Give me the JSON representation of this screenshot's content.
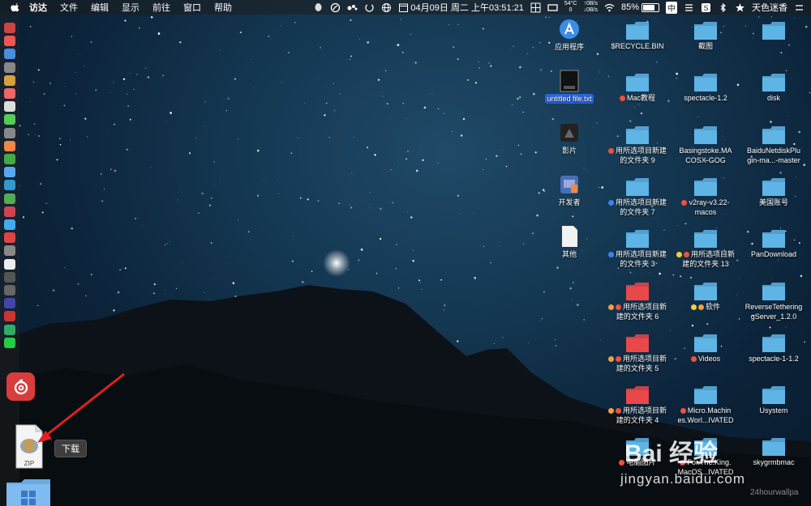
{
  "menubar": {
    "app_name": "访达",
    "menus": [
      "文件",
      "编辑",
      "显示",
      "前往",
      "窗口",
      "帮助"
    ],
    "datetime": "04月09日 周二 上午03:51:21",
    "cpu": {
      "temp": "54°C",
      "value": "0"
    },
    "net": {
      "up": "0B/s",
      "down": "0B/s"
    },
    "battery": "85%",
    "input_method": "中",
    "user": "天色迷香"
  },
  "dock": {
    "tooltip": "下载",
    "zip_label": "ZIP"
  },
  "desktop": {
    "left_column": [
      {
        "label": "应用程序",
        "icon": "app-store-icon"
      },
      {
        "label": "untitled file.txt",
        "icon": "txt-file-icon",
        "selected": true
      },
      {
        "label": "影片",
        "icon": "movies-icon"
      },
      {
        "label": "开发者",
        "icon": "developer-icon"
      },
      {
        "label": "其他",
        "icon": "document-icon"
      }
    ],
    "col2": [
      {
        "line1": "$RECYCLE.BIN",
        "line2": "",
        "color": "#5fb4e6",
        "tags": []
      },
      {
        "line1": "Mac教程",
        "line2": "",
        "color": "#5fb4e6",
        "tags": [
          "#f0503c"
        ]
      },
      {
        "line1": "用所选项目新建",
        "line2": "的文件夹 9",
        "color": "#5fb4e6",
        "tags": [
          "#f0503c"
        ]
      },
      {
        "line1": "用所选项目新建",
        "line2": "的文件夹 7",
        "color": "#5fb4e6",
        "tags": [
          "#3c82f0"
        ]
      },
      {
        "line1": "用所选项目新建",
        "line2": "的文件夹 3",
        "color": "#5fb4e6",
        "tags": [
          "#3c82f0"
        ]
      },
      {
        "line1": "用所选项目新",
        "line2": "建的文件夹 6",
        "color": "#e8484a",
        "tags": [
          "#f0a03c",
          "#f0503c"
        ]
      },
      {
        "line1": "用所选项目新",
        "line2": "建的文件夹 5",
        "color": "#e8484a",
        "tags": [
          "#f0a03c",
          "#f0503c"
        ]
      },
      {
        "line1": "用所选项目新",
        "line2": "建的文件夹 4",
        "color": "#e8484a",
        "tags": [
          "#f0a03c",
          "#f0503c"
        ]
      },
      {
        "line1": "电脑图片",
        "line2": "",
        "color": "#5fb4e6",
        "tags": [
          "#f0503c"
        ]
      }
    ],
    "col3": [
      {
        "line1": "截图",
        "line2": "",
        "color": "#5fb4e6",
        "tags": []
      },
      {
        "line1": "spectacle-1.2",
        "line2": "",
        "color": "#5fb4e6",
        "tags": []
      },
      {
        "line1": "Basingstoke.MA",
        "line2": "COSX-GOG",
        "color": "#5fb4e6",
        "tags": []
      },
      {
        "line1": "v2ray-v3.22-",
        "line2": "macos",
        "color": "#5fb4e6",
        "tags": [
          "#f0503c"
        ]
      },
      {
        "line1": "用所选项目新",
        "line2": "建的文件夹 13",
        "color": "#5fb4e6",
        "tags": [
          "#f0d03c",
          "#f0503c"
        ]
      },
      {
        "line1": "软件",
        "line2": "",
        "color": "#5fb4e6",
        "tags": [
          "#f0d03c",
          "#f0a03c"
        ]
      },
      {
        "line1": "Videos",
        "line2": "",
        "color": "#5fb4e6",
        "tags": [
          "#f0503c"
        ]
      },
      {
        "line1": "Micro.Machin",
        "line2": "es.Worl...IVATED",
        "color": "#5fb4e6",
        "tags": [
          "#f0503c"
        ]
      },
      {
        "line1": "For.The.King.",
        "line2": "MacOS...IVATED",
        "color": "#5fb4e6",
        "tags": [
          "#f0503c"
        ]
      }
    ],
    "col4": [
      {
        "line1": "",
        "line2": "",
        "color": "#5fb4e6"
      },
      {
        "line1": "disk",
        "line2": "",
        "color": "#5fb4e6"
      },
      {
        "line1": "BaiduNetdiskPlu",
        "line2": "gin-ma...-master",
        "color": "#5fb4e6"
      },
      {
        "line1": "美国账号",
        "line2": "",
        "color": "#5fb4e6"
      },
      {
        "line1": "PanDownload",
        "line2": "",
        "color": "#5fb4e6"
      },
      {
        "line1": "ReverseTethering",
        "line2": "gServer_1.2.0",
        "color": "#5fb4e6"
      },
      {
        "line1": "spectacle-1-1.2",
        "line2": "",
        "color": "#5fb4e6"
      },
      {
        "line1": "Usystem",
        "line2": "",
        "color": "#5fb4e6"
      },
      {
        "line1": "skygrmbmac",
        "line2": "",
        "color": "#5fb4e6"
      }
    ]
  },
  "watermark": {
    "brand": "Bai 经验",
    "url": "jingyan.baidu.com",
    "credit": "24hourwallpa"
  },
  "colors": {
    "selection": "#2a66d9",
    "folder_blue": "#5fb4e6",
    "folder_red": "#e8484a",
    "arrow": "#e02020"
  }
}
